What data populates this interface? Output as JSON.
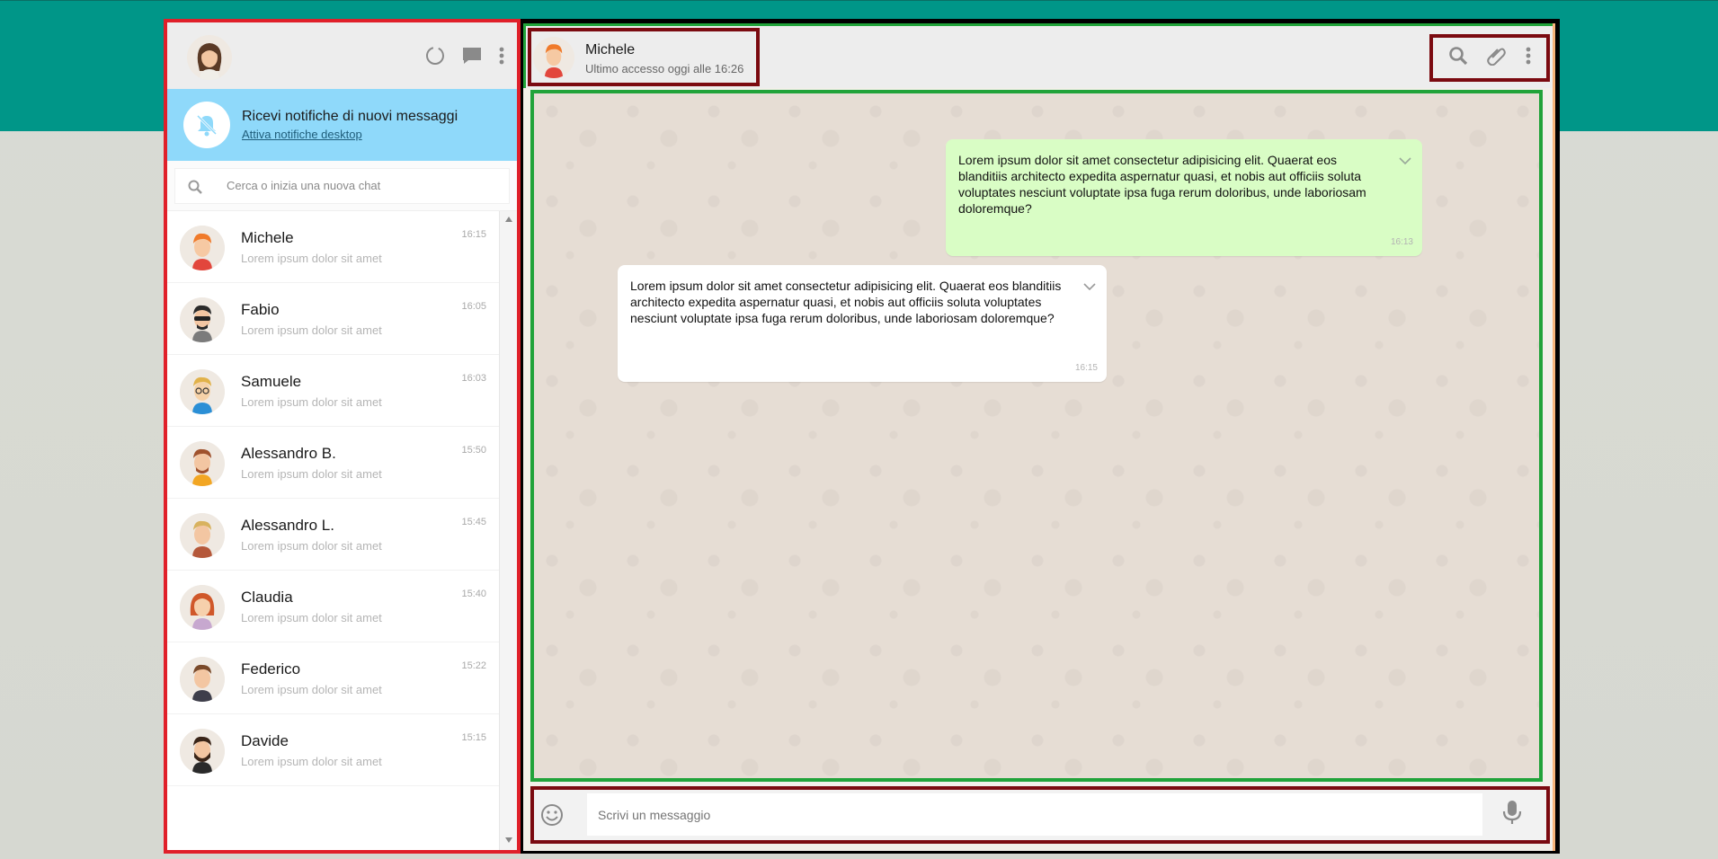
{
  "sidebar": {
    "notification": {
      "title": "Ricevi notifiche di nuovi messaggi",
      "link": "Attiva notifiche desktop"
    },
    "search": {
      "placeholder": "Cerca o inizia una nuova chat"
    },
    "chats": [
      {
        "name": "Michele",
        "preview": "Lorem ipsum dolor sit amet",
        "time": "16:15"
      },
      {
        "name": "Fabio",
        "preview": "Lorem ipsum dolor sit amet",
        "time": "16:05"
      },
      {
        "name": "Samuele",
        "preview": "Lorem ipsum dolor sit amet",
        "time": "16:03"
      },
      {
        "name": "Alessandro B.",
        "preview": "Lorem ipsum dolor sit amet",
        "time": "15:50"
      },
      {
        "name": "Alessandro L.",
        "preview": "Lorem ipsum dolor sit amet",
        "time": "15:45"
      },
      {
        "name": "Claudia",
        "preview": "Lorem ipsum dolor sit amet",
        "time": "15:40"
      },
      {
        "name": "Federico",
        "preview": "Lorem ipsum dolor sit amet",
        "time": "15:22"
      },
      {
        "name": "Davide",
        "preview": "Lorem ipsum dolor sit amet",
        "time": "15:15"
      }
    ]
  },
  "conversation": {
    "contact_name": "Michele",
    "last_seen": "Ultimo accesso oggi alle 16:26",
    "messages": [
      {
        "direction": "sent",
        "text": "Lorem ipsum dolor sit amet consectetur adipisicing elit. Quaerat eos blanditiis architecto expedita aspernatur quasi, et nobis aut officiis soluta voluptates nesciunt voluptate ipsa fuga rerum doloribus, unde laboriosam doloremque?",
        "time": "16:13"
      },
      {
        "direction": "received",
        "text": "Lorem ipsum dolor sit amet consectetur adipisicing elit. Quaerat eos blanditiis architecto expedita aspernatur quasi, et nobis aut officiis soluta voluptates nesciunt voluptate ipsa fuga rerum doloribus, unde laboriosam doloremque?",
        "time": "16:15"
      }
    ]
  },
  "composer": {
    "placeholder": "Scrivi un messaggio"
  },
  "colors": {
    "header_band": "#009688",
    "notification_bg": "#8fd9fa",
    "sent_bubble": "#d9fdc5",
    "received_bubble": "#ffffff"
  },
  "icons": [
    "status-icon",
    "new-chat-icon",
    "menu-icon",
    "bell-off-icon",
    "search-icon",
    "attach-icon",
    "emoji-icon",
    "mic-icon",
    "chevron-down-icon"
  ]
}
